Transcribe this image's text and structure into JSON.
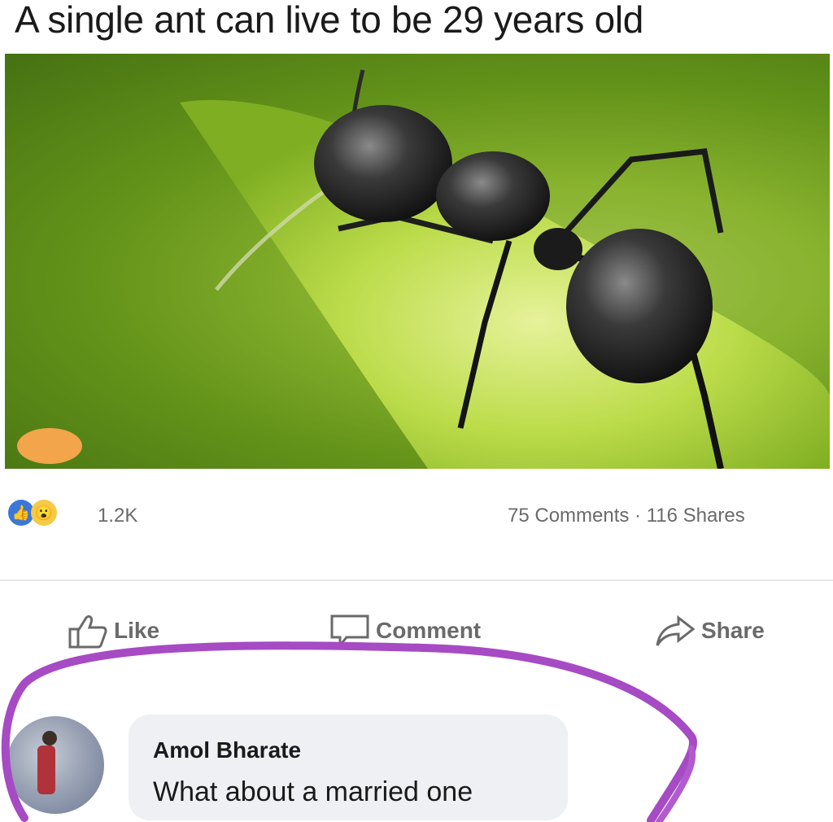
{
  "post": {
    "title": "A single ant can live to be 29 years old"
  },
  "photo": {
    "subject_icon": "ant-photo"
  },
  "stats": {
    "reaction_count": "1.2K",
    "comments_shares": "75 Comments · 116 Shares"
  },
  "actions": {
    "like_label": "Like",
    "comment_label": "Comment",
    "share_label": "Share"
  },
  "comment": {
    "author": "Amol Bharate",
    "text": "What about a married one"
  },
  "colors": {
    "annotation": "#a64bc4",
    "like_blue": "#3b77d8",
    "wow_yellow": "#f7c948",
    "meta_gray": "#6a6a6a"
  }
}
